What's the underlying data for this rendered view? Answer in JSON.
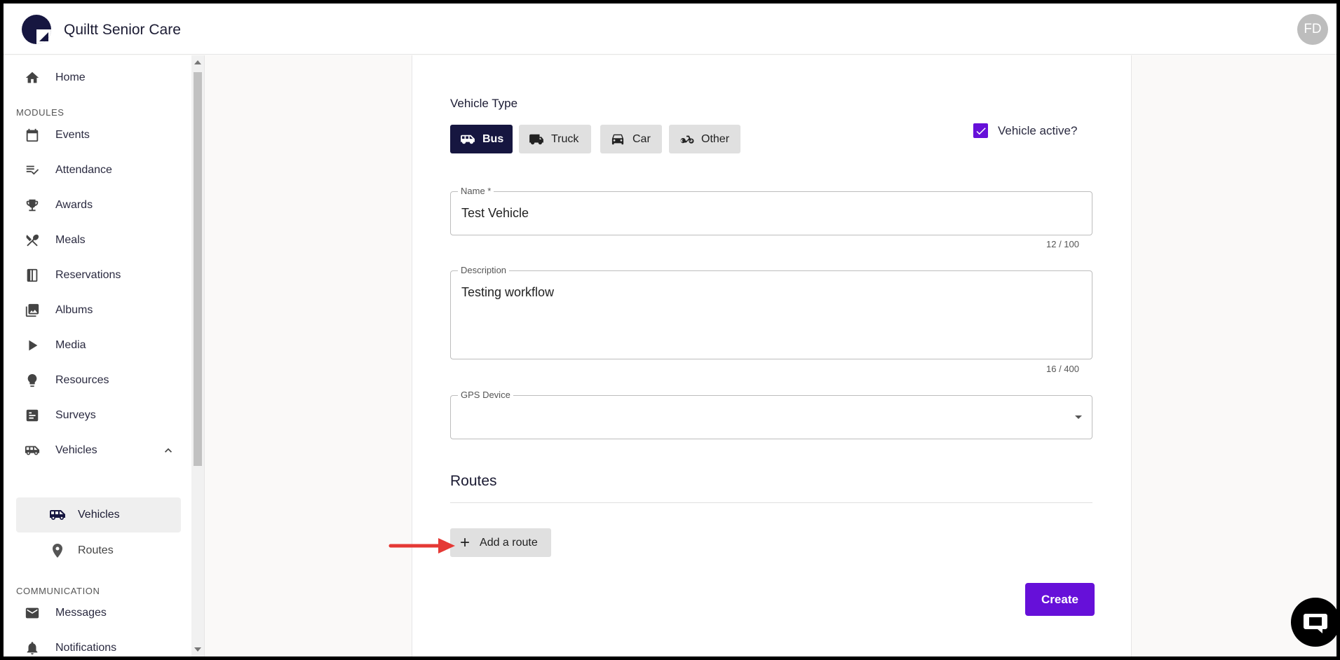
{
  "header": {
    "title": "Quiltt Senior Care",
    "avatar_initials": "FD"
  },
  "sidebar": {
    "home": "Home",
    "modules_label": "MODULES",
    "items": [
      {
        "label": "Events",
        "icon": "calendar-icon"
      },
      {
        "label": "Attendance",
        "icon": "checklist-icon"
      },
      {
        "label": "Awards",
        "icon": "trophy-icon"
      },
      {
        "label": "Meals",
        "icon": "utensils-icon"
      },
      {
        "label": "Reservations",
        "icon": "book-icon"
      },
      {
        "label": "Albums",
        "icon": "photos-icon"
      },
      {
        "label": "Media",
        "icon": "play-icon"
      },
      {
        "label": "Resources",
        "icon": "lightbulb-icon"
      },
      {
        "label": "Surveys",
        "icon": "survey-icon"
      },
      {
        "label": "Vehicles",
        "icon": "van-icon"
      }
    ],
    "vehicles_sub": [
      {
        "label": "Vehicles",
        "icon": "van-icon",
        "active": true
      },
      {
        "label": "Routes",
        "icon": "pin-icon",
        "active": false
      }
    ],
    "communication_label": "COMMUNICATION",
    "comm_items": [
      {
        "label": "Messages",
        "icon": "mail-icon"
      },
      {
        "label": "Notifications",
        "icon": "bell-icon"
      }
    ]
  },
  "form": {
    "vehicle_type_label": "Vehicle Type",
    "vehicle_types": [
      "Bus",
      "Truck",
      "Car",
      "Other"
    ],
    "selected_type": "Bus",
    "active_label": "Vehicle active?",
    "active_checked": true,
    "name_label": "Name *",
    "name_value": "Test Vehicle",
    "name_counter": "12 / 100",
    "description_label": "Description",
    "description_value": "Testing workflow",
    "description_counter": "16 / 400",
    "gps_label": "GPS Device",
    "gps_value": "",
    "routes_title": "Routes",
    "add_route_label": "Add a route",
    "create_label": "Create"
  },
  "colors": {
    "accent": "#6610d9",
    "selected": "#161640",
    "annotation_arrow": "#e53935"
  }
}
